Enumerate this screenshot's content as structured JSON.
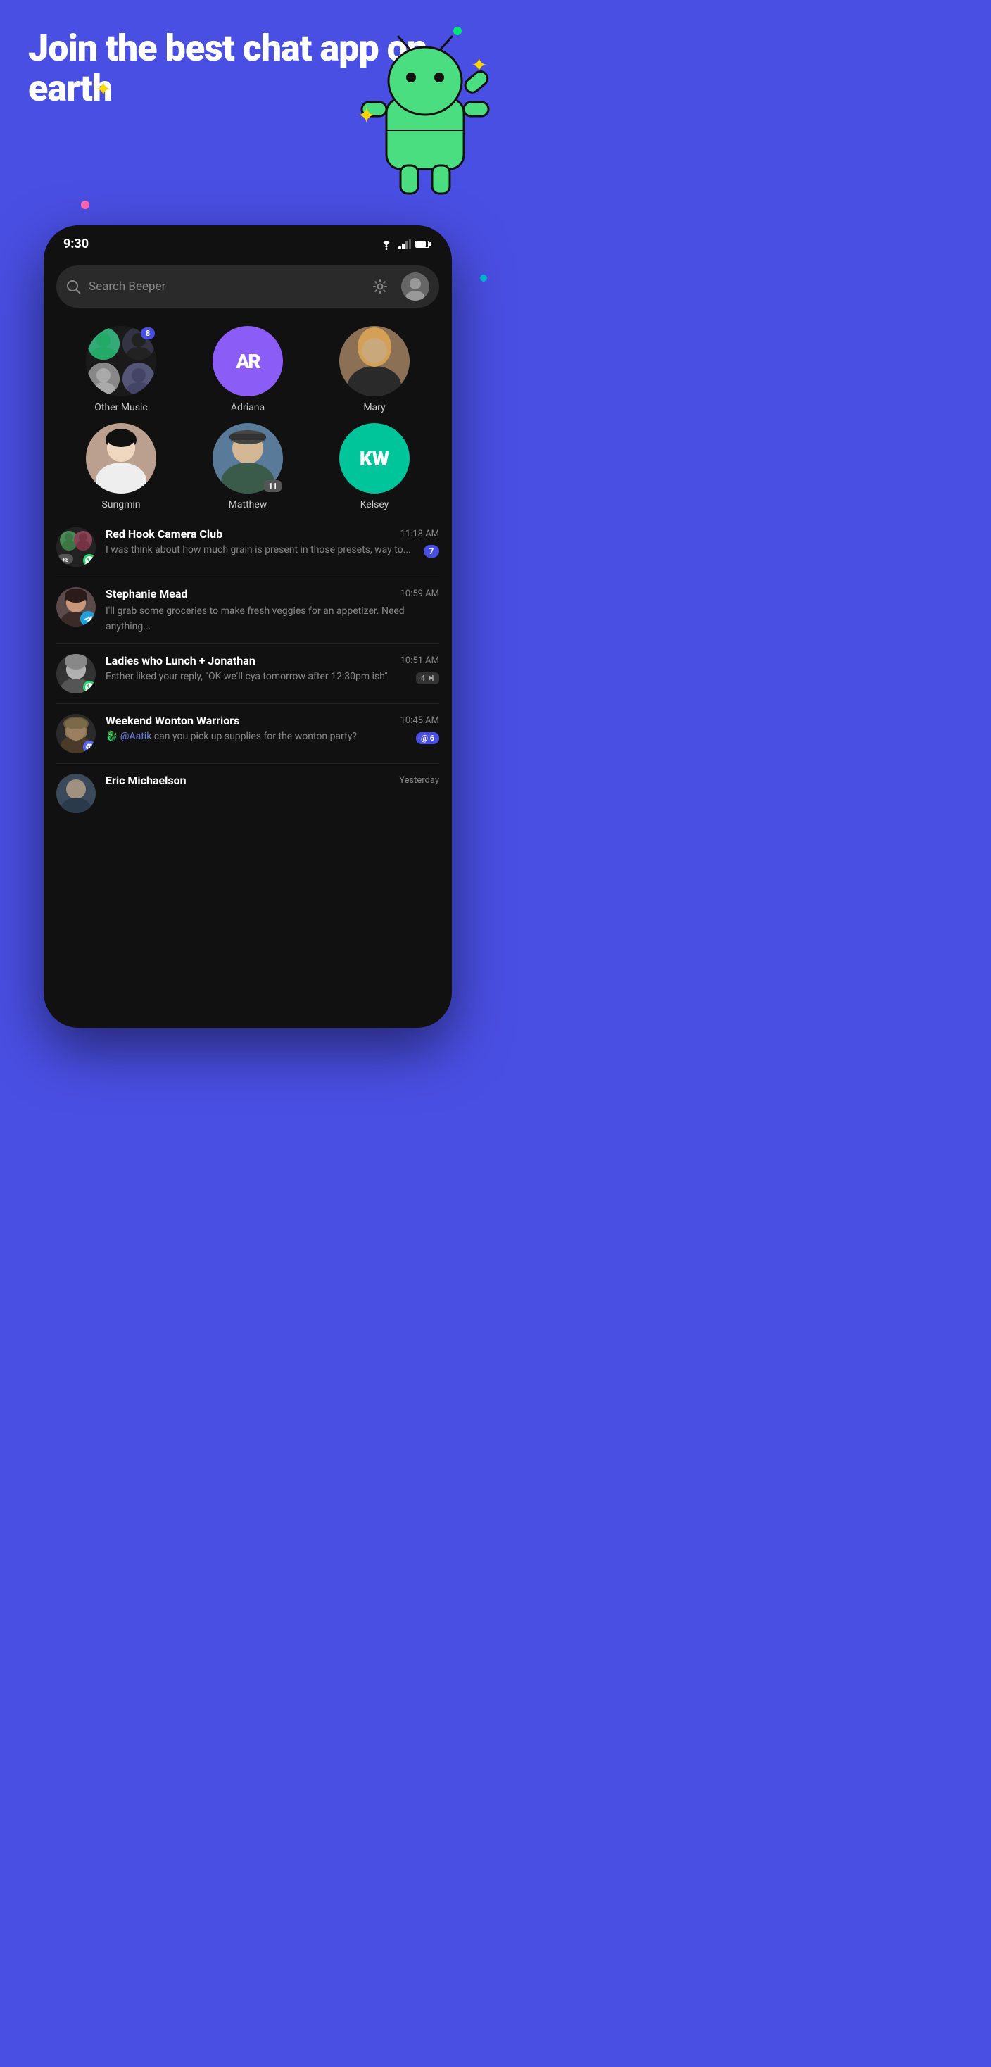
{
  "hero": {
    "title": "Join the best chat app on earth",
    "background_color": "#4A4FE4"
  },
  "status_bar": {
    "time": "9:30"
  },
  "search": {
    "placeholder": "Search Beeper"
  },
  "stories": [
    {
      "id": "other-music",
      "label": "Other Music",
      "badge": "8",
      "type": "group"
    },
    {
      "id": "adriana",
      "label": "Adriana",
      "initials": "AR",
      "type": "initials",
      "bg": "#8B5CF6"
    },
    {
      "id": "mary",
      "label": "Mary",
      "type": "photo"
    }
  ],
  "stories2": [
    {
      "id": "sungmin",
      "label": "Sungmin",
      "type": "photo"
    },
    {
      "id": "matthew",
      "label": "Matthew",
      "badge": "11",
      "type": "photo"
    },
    {
      "id": "kelsey",
      "label": "Kelsey",
      "initials": "KW",
      "type": "initials",
      "bg": "#00C49A"
    }
  ],
  "chats": [
    {
      "id": "red-hook",
      "name": "Red Hook Camera Club",
      "time": "11:18 AM",
      "preview": "I was think about how much grain is present in those presets, way to...",
      "badge_type": "unread",
      "badge_value": "7",
      "service": "whatsapp"
    },
    {
      "id": "stephanie",
      "name": "Stephanie Mead",
      "time": "10:59 AM",
      "preview": "I'll grab some groceries to make fresh veggies for an appetizer. Need anything...",
      "badge_type": "none",
      "service": "telegram"
    },
    {
      "id": "ladies-lunch",
      "name": "Ladies who Lunch + Jonathan",
      "time": "10:51 AM",
      "preview": "Esther liked your reply, \"OK we'll cya tomorrow after 12:30pm ish\"",
      "badge_type": "muted",
      "badge_value": "4",
      "service": "whatsapp"
    },
    {
      "id": "wonton",
      "name": "Weekend Wonton Warriors",
      "time": "10:45 AM",
      "preview": "@Aatik can you pick up supplies for the wonton party?",
      "badge_type": "mention",
      "badge_value": "@ 6",
      "service": "discord"
    },
    {
      "id": "eric",
      "name": "Eric Michaelson",
      "time": "Yesterday",
      "preview": "",
      "badge_type": "none",
      "service": "none"
    }
  ],
  "labels": {
    "gear": "⚙",
    "search_icon": "🔍",
    "whatsapp_icon": "W",
    "telegram_icon": "✈",
    "discord_icon": "D"
  }
}
